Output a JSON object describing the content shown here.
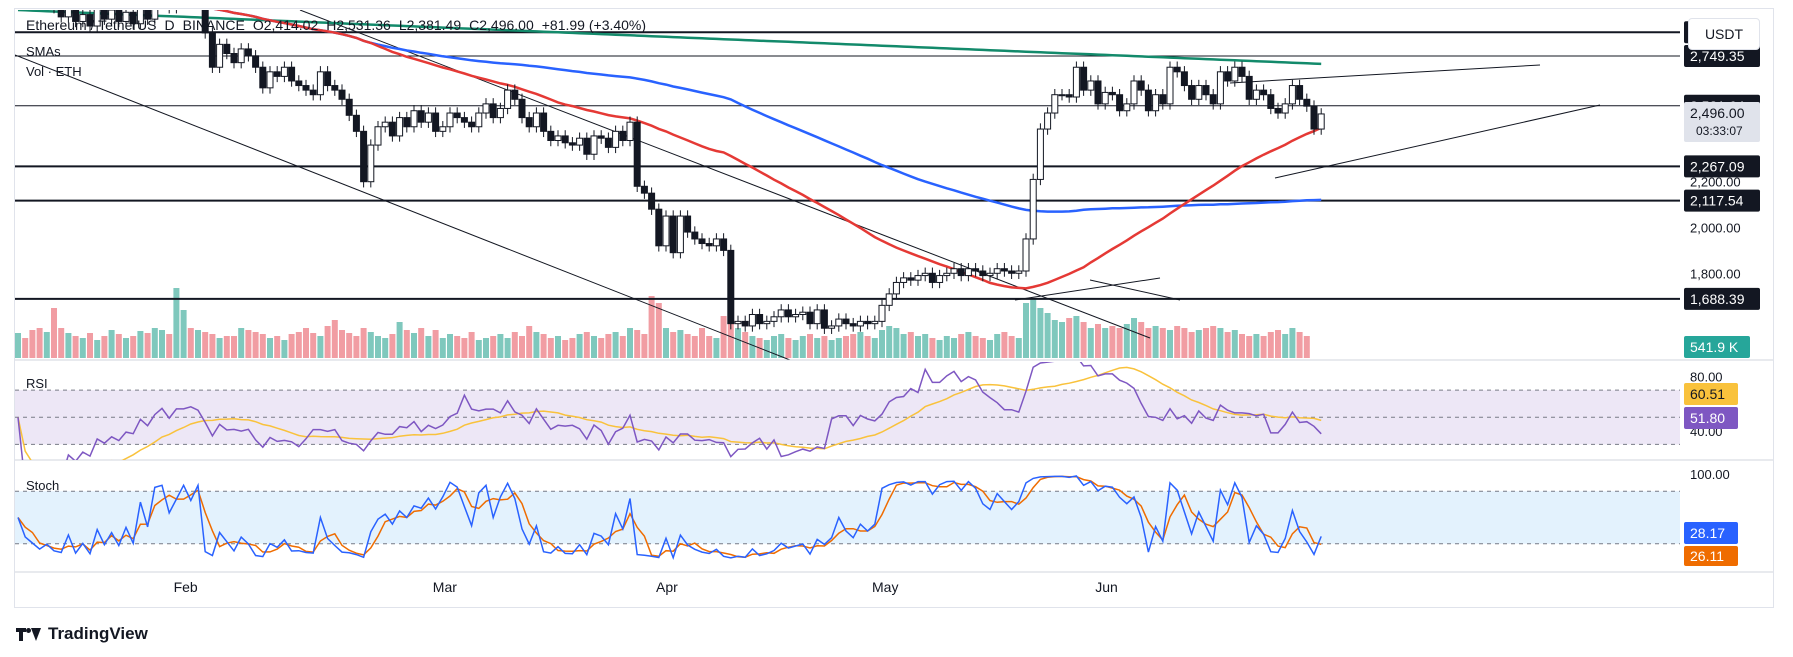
{
  "header": {
    "symbol": "Ethereum / TetherUS",
    "interval": "D",
    "exchange": "BINANCE",
    "open": "O2,414.02",
    "high": "H2,531.36",
    "low": "L2,381.49",
    "close": "C2,496.00",
    "change": "+81.99 (+3.40%)",
    "indicator_sma": "SMAs",
    "indicator_vol": "Vol · ETH",
    "currency": "USDT"
  },
  "panels": {
    "rsi_label": "RSI",
    "stoch_label": "Stoch"
  },
  "footer": {
    "brand": "TradingView"
  },
  "colors": {
    "up": "#ffffff",
    "down": "#131722",
    "vol_up": "#7fc8bd",
    "vol_down": "#f19da3",
    "sma50": "#e53935",
    "sma100": "#2962ff",
    "sma200": "#138a6b",
    "rsi": "#7e57c2",
    "rsi_ma": "#f9c23c",
    "stoch_k": "#2962ff",
    "stoch_d": "#ef6c00"
  },
  "chart_data": [
    {
      "type": "candlestick",
      "x_ticks": [
        "Feb",
        "Mar",
        "Apr",
        "May",
        "Jun"
      ],
      "y_ticks": [
        "2,200.00",
        "2,000.00",
        "1,800.00"
      ],
      "ylim": [
        1430,
        2950
      ],
      "horizontal_levels": [
        {
          "value": 2852.82,
          "label": "2,852.82"
        },
        {
          "value": 2749.35,
          "label": "2,749.35"
        },
        {
          "value": 2531.64,
          "label": "2,531.64"
        },
        {
          "value": 2267.09,
          "label": "2,267.09"
        },
        {
          "value": 2117.54,
          "label": "2,117.54"
        },
        {
          "value": 1688.39,
          "label": "1,688.39"
        }
      ],
      "last_price": {
        "value": 2496.0,
        "label": "2,496.00",
        "countdown": "03:33:07"
      },
      "volume_label": "541.9 K",
      "closes": [
        3120,
        3080,
        3050,
        2990,
        3000,
        2960,
        2920,
        2970,
        2900,
        2930,
        2880,
        2960,
        2910,
        2950,
        2900,
        2940,
        2890,
        2970,
        2910,
        2990,
        3020,
        2960,
        2990,
        3020,
        2990,
        3030,
        2850,
        2700,
        2800,
        2760,
        2720,
        2780,
        2750,
        2700,
        2610,
        2680,
        2660,
        2700,
        2640,
        2620,
        2600,
        2580,
        2680,
        2620,
        2600,
        2560,
        2490,
        2420,
        2200,
        2360,
        2440,
        2460,
        2400,
        2480,
        2440,
        2510,
        2460,
        2500,
        2420,
        2440,
        2500,
        2480,
        2460,
        2440,
        2500,
        2540,
        2480,
        2520,
        2600,
        2560,
        2480,
        2440,
        2500,
        2420,
        2380,
        2400,
        2370,
        2360,
        2390,
        2320,
        2400,
        2390,
        2350,
        2420,
        2380,
        2460,
        2180,
        2150,
        2080,
        1920,
        2050,
        1890,
        2050,
        1980,
        1950,
        1930,
        1920,
        1950,
        1900,
        1580,
        1590,
        1570,
        1620,
        1580,
        1590,
        1610,
        1640,
        1610,
        1620,
        1630,
        1580,
        1640,
        1560,
        1570,
        1600,
        1580,
        1570,
        1590,
        1580,
        1590,
        1660,
        1710,
        1760,
        1780,
        1770,
        1790,
        1800,
        1760,
        1790,
        1800,
        1820,
        1790,
        1820,
        1810,
        1790,
        1800,
        1820,
        1810,
        1800,
        1810,
        1950,
        2210,
        2430,
        2500,
        2580,
        2580,
        2570,
        2700,
        2600,
        2640,
        2540,
        2590,
        2580,
        2510,
        2540,
        2640,
        2600,
        2510,
        2580,
        2540,
        2700,
        2680,
        2620,
        2560,
        2620,
        2580,
        2540,
        2680,
        2640,
        2700,
        2660,
        2560,
        2600,
        2580,
        2520,
        2500,
        2540,
        2620,
        2560,
        2530,
        2430,
        2496
      ],
      "volumes": [
        0.25,
        0.2,
        0.28,
        0.3,
        0.26,
        0.5,
        0.3,
        0.25,
        0.22,
        0.2,
        0.25,
        0.18,
        0.22,
        0.28,
        0.24,
        0.2,
        0.22,
        0.27,
        0.25,
        0.3,
        0.28,
        0.24,
        0.7,
        0.48,
        0.3,
        0.28,
        0.26,
        0.24,
        0.2,
        0.22,
        0.22,
        0.3,
        0.28,
        0.26,
        0.24,
        0.2,
        0.22,
        0.18,
        0.24,
        0.26,
        0.3,
        0.25,
        0.22,
        0.32,
        0.38,
        0.28,
        0.25,
        0.22,
        0.3,
        0.26,
        0.22,
        0.2,
        0.24,
        0.36,
        0.28,
        0.25,
        0.3,
        0.22,
        0.28,
        0.2,
        0.24,
        0.22,
        0.2,
        0.26,
        0.18,
        0.2,
        0.22,
        0.24,
        0.2,
        0.26,
        0.22,
        0.32,
        0.26,
        0.24,
        0.2,
        0.22,
        0.18,
        0.2,
        0.24,
        0.26,
        0.22,
        0.2,
        0.24,
        0.26,
        0.22,
        0.3,
        0.28,
        0.24,
        0.62,
        0.55,
        0.3,
        0.26,
        0.28,
        0.24,
        0.22,
        0.3,
        0.22,
        0.2,
        0.42,
        0.36,
        0.3,
        0.26,
        0.22,
        0.2,
        0.18,
        0.22,
        0.24,
        0.2,
        0.18,
        0.22,
        0.24,
        0.2,
        0.22,
        0.18,
        0.2,
        0.22,
        0.24,
        0.26,
        0.22,
        0.2,
        0.28,
        0.32,
        0.3,
        0.24,
        0.26,
        0.22,
        0.24,
        0.2,
        0.18,
        0.22,
        0.2,
        0.24,
        0.26,
        0.22,
        0.2,
        0.18,
        0.24,
        0.26,
        0.22,
        0.2,
        0.55,
        0.6,
        0.5,
        0.45,
        0.38,
        0.36,
        0.4,
        0.42,
        0.36,
        0.3,
        0.34,
        0.3,
        0.32,
        0.3,
        0.34,
        0.4,
        0.36,
        0.3,
        0.32,
        0.3,
        0.28,
        0.32,
        0.3,
        0.26,
        0.28,
        0.3,
        0.32,
        0.3,
        0.26,
        0.28,
        0.24,
        0.22,
        0.24,
        0.22,
        0.26,
        0.28,
        0.24,
        0.3,
        0.26,
        0.22
      ]
    },
    {
      "type": "line",
      "name": "RSI",
      "y_ticks": [
        "80.00",
        "40.00"
      ],
      "ylim": [
        20,
        90
      ],
      "last_values": {
        "rsi_ma": "60.51",
        "rsi": "51.80"
      }
    },
    {
      "type": "line",
      "name": "Stoch",
      "y_ticks": [
        "100.00"
      ],
      "ylim": [
        -10,
        110
      ],
      "last_values": {
        "k": "28.17",
        "d": "26.11"
      }
    }
  ]
}
